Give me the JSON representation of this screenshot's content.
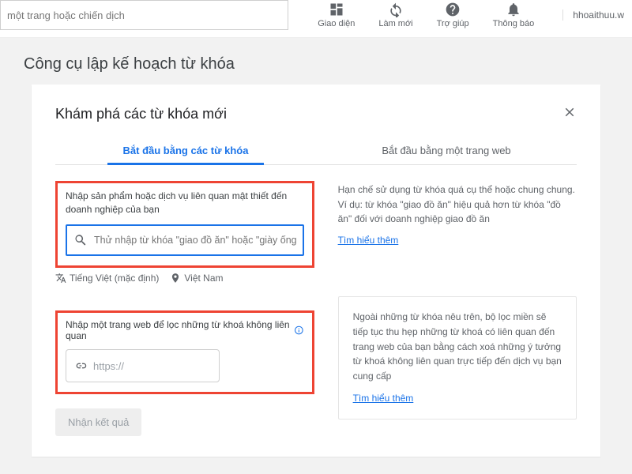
{
  "topbar": {
    "search_placeholder": "một trang hoặc chiến dịch",
    "icons": {
      "appearance": "Giao diện",
      "refresh": "Làm mới",
      "help": "Trợ giúp",
      "notifications": "Thông báo"
    },
    "account_label": "hhoaithuu.w"
  },
  "page_title": "Công cụ lập kế hoạch từ khóa",
  "card": {
    "title": "Khám phá các từ khóa mới",
    "tabs": {
      "keywords": "Bắt đầu bằng các từ khóa",
      "website": "Bắt đầu bằng một trang web"
    },
    "kw_label": "Nhập sản phẩm hoặc dịch vụ liên quan mật thiết đến doanh nghiệp của bạn",
    "kw_placeholder": "Thử nhập từ khóa \"giao đồ ăn\" hoặc \"giày ống bằng da\"",
    "tip_text": "Hạn chế sử dụng từ khóa quá cụ thể hoặc chung chung. Ví dụ: từ khóa \"giao đồ ăn\" hiệu quả hơn từ khóa \"đồ ăn\" đối với doanh nghiệp giao đồ ăn",
    "learn_more": "Tìm hiểu thêm",
    "language_label": "Tiếng Việt (mặc định)",
    "location_label": "Việt Nam",
    "url_filter_label": "Nhập một trang web để lọc những từ khoá không liên quan",
    "url_placeholder": "https://",
    "note_text": "Ngoài những từ khóa nêu trên, bộ lọc miền sẽ tiếp tục thu hẹp những từ khoá có liên quan đến trang web của bạn bằng cách xoá những ý tưởng từ khoá không liên quan trực tiếp đến dịch vụ bạn cung cấp",
    "submit_label": "Nhận kết quả"
  }
}
